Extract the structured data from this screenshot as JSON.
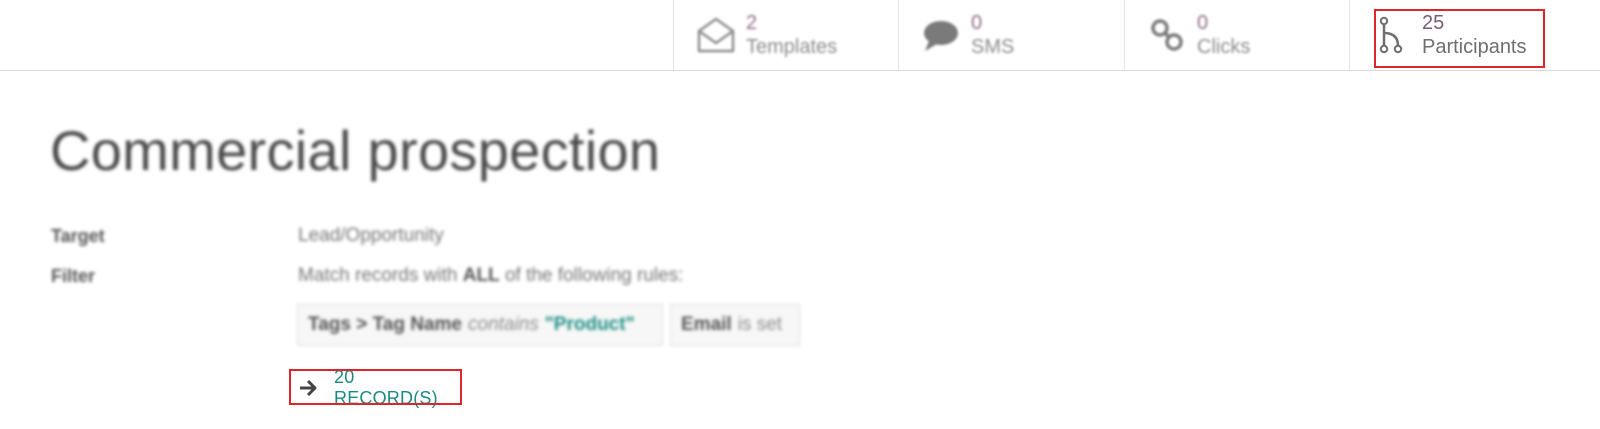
{
  "stats": {
    "templates": {
      "value": "2",
      "label": "Templates"
    },
    "sms": {
      "value": "0",
      "label": "SMS"
    },
    "clicks": {
      "value": "0",
      "label": "Clicks"
    },
    "participants": {
      "value": "25",
      "label": "Participants"
    }
  },
  "title": "Commercial prospection",
  "fields": {
    "target": {
      "label": "Target",
      "value": "Lead/Opportunity"
    },
    "filter": {
      "label": "Filter",
      "prefix": "Match records with",
      "quantifier": "ALL",
      "suffix": "of the following rules:"
    }
  },
  "rules": [
    {
      "field": "Tags > Tag Name",
      "operator": "contains",
      "value": "\"Product\""
    },
    {
      "field": "Email",
      "operator": "is set",
      "value": ""
    }
  ],
  "records_link": {
    "label": "20 RECORD(S)"
  },
  "colors": {
    "accent": "#8f6a86",
    "link": "#1b8a82",
    "highlight": "#e0242b"
  }
}
